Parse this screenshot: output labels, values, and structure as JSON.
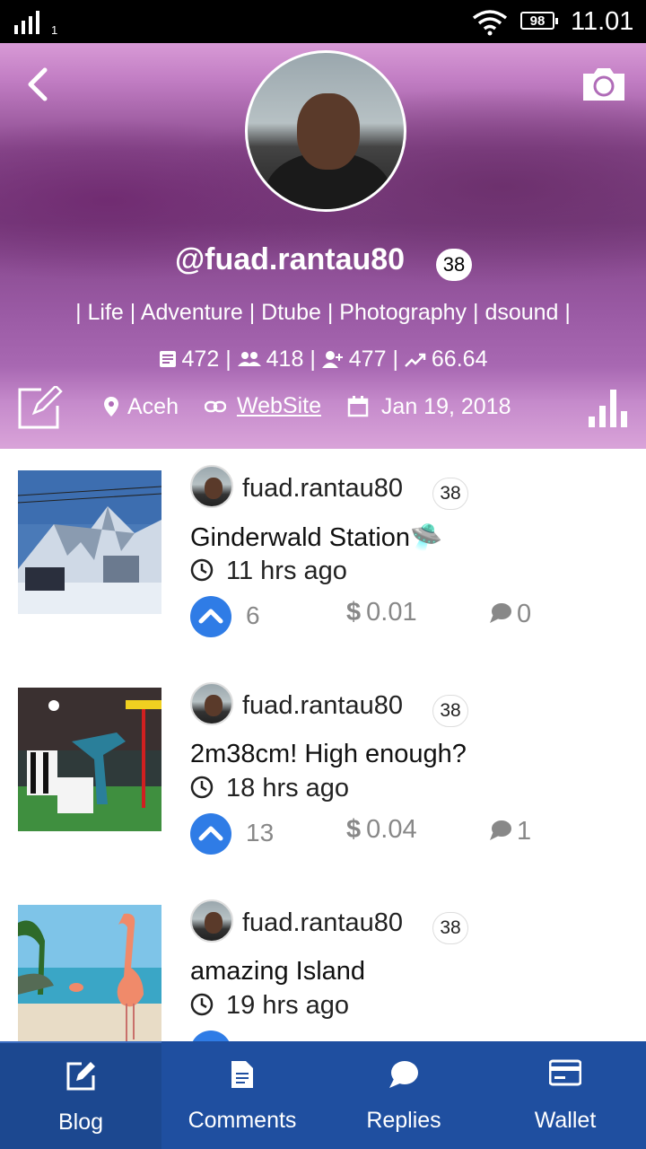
{
  "status_bar": {
    "signal_sim": "1",
    "battery": "98",
    "time": "11.01"
  },
  "profile": {
    "username": "@fuad.rantau80",
    "reputation": "38",
    "about": "| Life | Adventure | Dtube | Photography | dsound |",
    "stats": {
      "posts": "472",
      "followers": "418",
      "following": "477",
      "sp": "66.64"
    },
    "location": "Aceh",
    "website_label": "WebSite",
    "joined": "Jan 19, 2018"
  },
  "posts": [
    {
      "author": "fuad.rantau80",
      "reputation": "38",
      "title": "Ginderwald Station🛸",
      "time": "11 hrs ago",
      "votes": "6",
      "payout": "0.01",
      "comments": "0"
    },
    {
      "author": "fuad.rantau80",
      "reputation": "38",
      "title": "2m38cm! High enough?",
      "time": "18 hrs ago",
      "votes": "13",
      "payout": "0.04",
      "comments": "1"
    },
    {
      "author": "fuad.rantau80",
      "reputation": "38",
      "title": "amazing Island",
      "time": "19 hrs ago",
      "votes": "",
      "payout": "",
      "comments": ""
    }
  ],
  "payout_symbol": "$",
  "bottom_nav": [
    {
      "label": "Blog",
      "icon": "edit-icon"
    },
    {
      "label": "Comments",
      "icon": "document-icon"
    },
    {
      "label": "Replies",
      "icon": "chat-bubble-icon"
    },
    {
      "label": "Wallet",
      "icon": "credit-card-icon"
    }
  ],
  "colors": {
    "accent": "#2f7ce6",
    "nav_bg": "#1f4fa0",
    "header_tint": "#b06cb8"
  }
}
